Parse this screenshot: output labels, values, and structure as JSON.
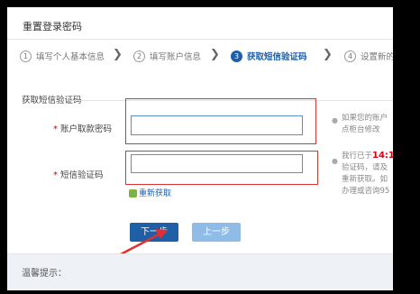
{
  "header": {
    "title": "重置登录密码"
  },
  "steps": [
    {
      "num": "1",
      "label": "填写个人基本信息"
    },
    {
      "num": "2",
      "label": "填写账户信息"
    },
    {
      "num": "3",
      "label": "获取短信验证码"
    },
    {
      "num": "4",
      "label": "设置新的"
    }
  ],
  "section": {
    "title": "获取短信验证码"
  },
  "form": {
    "required_mark": "*",
    "account_password_label": "账户取款密码",
    "sms_code_label": "短信验证码",
    "account_password_value": "",
    "sms_code_value": "",
    "refresh_label": "重新获取"
  },
  "tips": {
    "tip1_lines": [
      "如果您的账户",
      "点柜台修改"
    ],
    "tip2_line1_prefix": "我行已于",
    "tip2_time": "14:1",
    "tip2_lines": [
      "验证码，请及",
      "重新获取。如",
      "办理或咨询95"
    ]
  },
  "buttons": {
    "next": "下一步",
    "prev": "上一步"
  },
  "bottom": {
    "warm_tip": "温馨提示："
  },
  "colors": {
    "primary": "#1f5fa8",
    "annotation": "#e23030",
    "highlight": "#d7000f"
  }
}
